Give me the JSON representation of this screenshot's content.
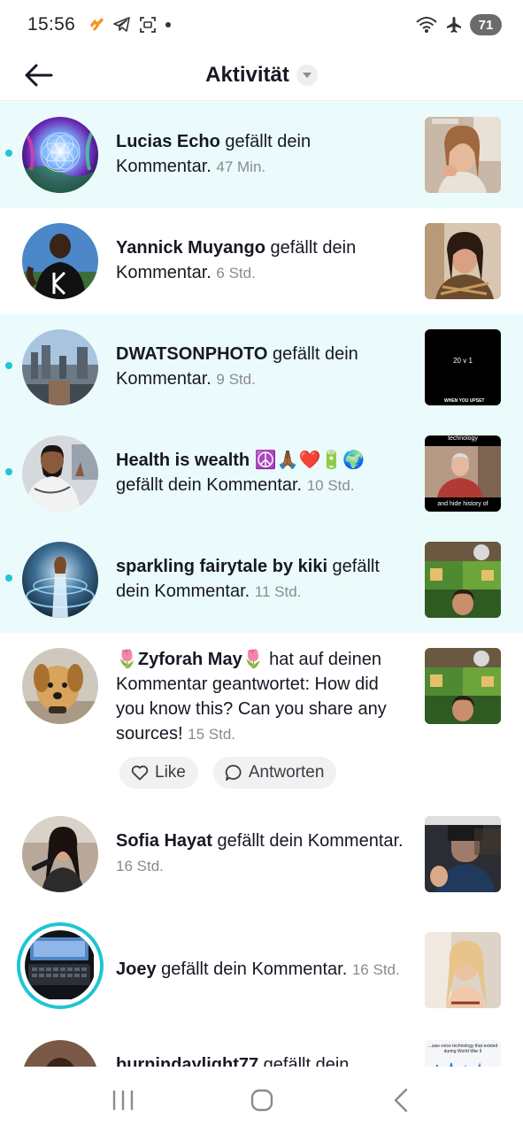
{
  "status_bar": {
    "time": "15:56",
    "battery": "71"
  },
  "header": {
    "title": "Aktivität"
  },
  "notifications": [
    {
      "name": "Lucias Echo",
      "action": " gefällt dein Kommentar.",
      "time": "47 Min.",
      "unread": true
    },
    {
      "name": "Yannick Muyango",
      "action": " gefällt dein Kommentar.",
      "time": "6 Std.",
      "unread": false
    },
    {
      "name": "DWATSONPHOTO",
      "action": " gefällt dein Kommentar.",
      "time": "9 Std.",
      "unread": true,
      "thumb_caption_top": "20 v 1",
      "thumb_caption_bottom": "WHEN YOU UPSET"
    },
    {
      "name": "Health is wealth ☮️🙏🏾❤️🔋🌍",
      "action": " gefällt dein Kommentar.",
      "time": "10 Std.",
      "unread": true,
      "thumb_caption_top": "technology",
      "thumb_caption_bottom": "and hide history of"
    },
    {
      "name": "sparkling fairytale by kiki",
      "action": " gefällt dein Kommentar.",
      "time": "11 Std.",
      "unread": true
    },
    {
      "name": "🌷Zyforah May🌷",
      "action": " hat auf deinen Kommentar geantwortet: How did you know this? Can you share any sources!",
      "time": "15 Std.",
      "unread": false
    },
    {
      "name": "Sofia Hayat",
      "action": " gefällt dein Kommentar.",
      "time": "16 Std.",
      "unread": false
    },
    {
      "name": "Joey",
      "action": " gefällt dein Kommentar.",
      "time": "16 Std.",
      "unread": false
    },
    {
      "name": "burnindaylight77",
      "action": " gefällt dein",
      "time": "",
      "unread": false,
      "thumb_caption_top": "...saw voice technology that existed during World War II"
    }
  ],
  "reply_actions": {
    "like": "Like",
    "reply": "Antworten"
  },
  "icons": {
    "back": "arrow-left-icon",
    "title_dropdown": "chevron-down-icon",
    "like": "heart-outline-icon",
    "reply": "speech-bubble-icon",
    "nav_recents": "recents-icon",
    "nav_home": "home-icon",
    "nav_back": "nav-back-icon"
  },
  "colors": {
    "accent": "#20c4d3",
    "unread_bg": "#ebfbfc",
    "text": "#161823",
    "muted": "#8a8b91"
  }
}
